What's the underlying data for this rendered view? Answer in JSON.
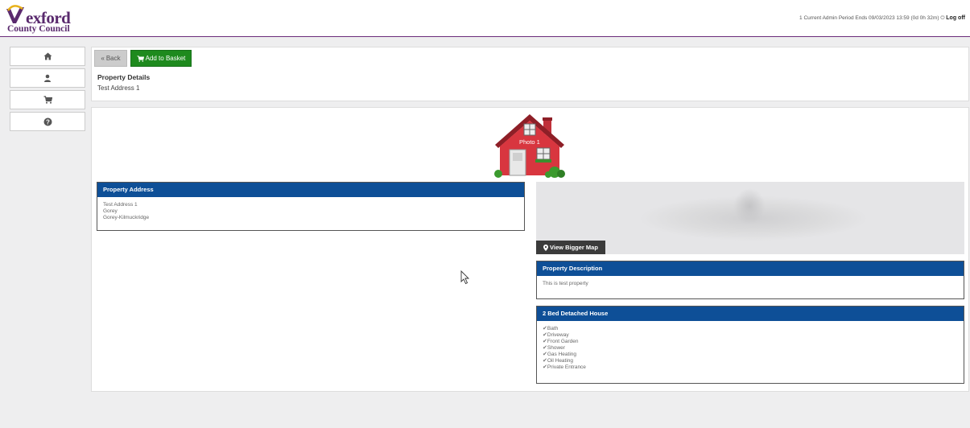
{
  "brand": {
    "name": "exford",
    "subname": "County Council"
  },
  "header": {
    "status": "1 Current Admin Period Ends 09/03/2023 13:59 (0d 0h 32m)",
    "logoff": "Log off"
  },
  "sidebar": {
    "items": [
      {
        "icon": "home-icon"
      },
      {
        "icon": "user-icon"
      },
      {
        "icon": "cart-icon"
      },
      {
        "icon": "help-icon"
      }
    ]
  },
  "toolbar": {
    "back_label": "Back",
    "add_label": "Add to Basket"
  },
  "property": {
    "heading": "Property Details",
    "address_line": "Test Address 1",
    "photo_label": "Photo 1"
  },
  "address_box": {
    "title": "Property Address",
    "lines": [
      "Test Address 1",
      "Gorey",
      "Gorey-Kilmuckridge"
    ]
  },
  "map": {
    "button_label": "View Bigger Map"
  },
  "description_box": {
    "title": "Property Description",
    "text": "This is test property"
  },
  "features_box": {
    "title": "2 Bed Detached House",
    "items": [
      "Bath",
      "Driveway",
      "Front Garden",
      "Shower",
      "Gas Heating",
      "Oil Heating",
      "Private Entrance"
    ]
  },
  "colors": {
    "brand_purple": "#5a2a6e",
    "panel_header_blue": "#0e4f97",
    "basket_green": "#1e8a1e"
  }
}
